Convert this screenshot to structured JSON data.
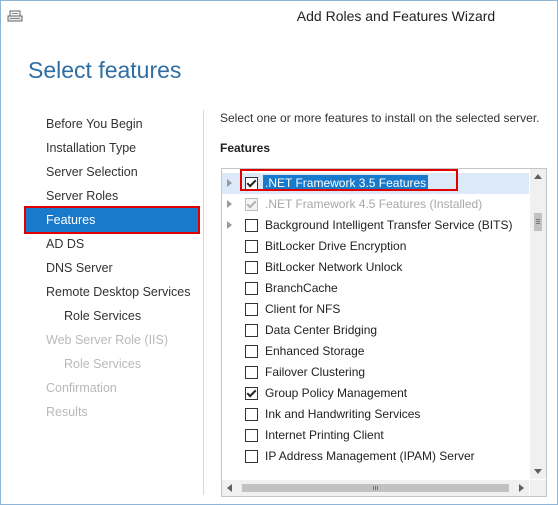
{
  "window": {
    "title": "Add Roles and Features Wizard",
    "icon": "server-manager-icon"
  },
  "page": {
    "header": "Select features"
  },
  "nav": {
    "items": [
      {
        "label": "Before You Begin",
        "state": "normal"
      },
      {
        "label": "Installation Type",
        "state": "normal"
      },
      {
        "label": "Server Selection",
        "state": "normal"
      },
      {
        "label": "Server Roles",
        "state": "normal"
      },
      {
        "label": "Features",
        "state": "active"
      },
      {
        "label": "AD DS",
        "state": "normal"
      },
      {
        "label": "DNS Server",
        "state": "normal"
      },
      {
        "label": "Remote Desktop Services",
        "state": "normal"
      },
      {
        "label": "Role Services",
        "state": "normal"
      },
      {
        "label": "Web Server Role (IIS)",
        "state": "disabled"
      },
      {
        "label": "Role Services",
        "state": "disabled"
      },
      {
        "label": "Confirmation",
        "state": "disabled"
      },
      {
        "label": "Results",
        "state": "disabled"
      }
    ]
  },
  "main": {
    "description": "Select one or more features to install on the selected server.",
    "features_label": "Features",
    "features": [
      {
        "label": ".NET Framework 3.5 Features",
        "checked": true,
        "expandable": true,
        "selected": true,
        "disabled": false
      },
      {
        "label": ".NET Framework 4.5 Features (Installed)",
        "checked": true,
        "expandable": true,
        "selected": false,
        "disabled": true
      },
      {
        "label": "Background Intelligent Transfer Service (BITS)",
        "checked": false,
        "expandable": true,
        "selected": false,
        "disabled": false
      },
      {
        "label": "BitLocker Drive Encryption",
        "checked": false,
        "expandable": false,
        "selected": false,
        "disabled": false
      },
      {
        "label": "BitLocker Network Unlock",
        "checked": false,
        "expandable": false,
        "selected": false,
        "disabled": false
      },
      {
        "label": "BranchCache",
        "checked": false,
        "expandable": false,
        "selected": false,
        "disabled": false
      },
      {
        "label": "Client for NFS",
        "checked": false,
        "expandable": false,
        "selected": false,
        "disabled": false
      },
      {
        "label": "Data Center Bridging",
        "checked": false,
        "expandable": false,
        "selected": false,
        "disabled": false
      },
      {
        "label": "Enhanced Storage",
        "checked": false,
        "expandable": false,
        "selected": false,
        "disabled": false
      },
      {
        "label": "Failover Clustering",
        "checked": false,
        "expandable": false,
        "selected": false,
        "disabled": false
      },
      {
        "label": "Group Policy Management",
        "checked": true,
        "expandable": false,
        "selected": false,
        "disabled": false
      },
      {
        "label": "Ink and Handwriting Services",
        "checked": false,
        "expandable": false,
        "selected": false,
        "disabled": false
      },
      {
        "label": "Internet Printing Client",
        "checked": false,
        "expandable": false,
        "selected": false,
        "disabled": false
      },
      {
        "label": "IP Address Management (IPAM) Server",
        "checked": false,
        "expandable": false,
        "selected": false,
        "disabled": false
      }
    ]
  },
  "colors": {
    "accent": "#1979ca",
    "header": "#2f6ea3",
    "highlight_box": "#e00000"
  }
}
